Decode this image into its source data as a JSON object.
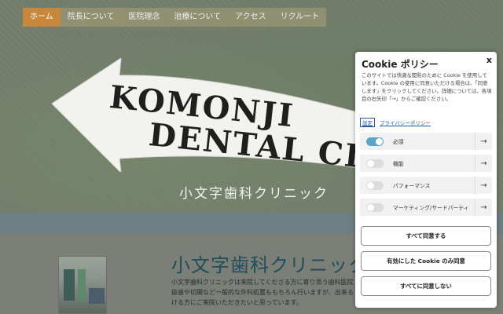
{
  "nav": {
    "items": [
      {
        "label": "ホーム",
        "active": true
      },
      {
        "label": "院長について",
        "active": false
      },
      {
        "label": "医院理念",
        "active": false
      },
      {
        "label": "治療について",
        "active": false
      },
      {
        "label": "アクセス",
        "active": false
      },
      {
        "label": "リクルート",
        "active": false
      }
    ]
  },
  "hero": {
    "banner_line1": "KOMONJI",
    "banner_line2": "DENTAL CLINI",
    "subtitle": "小文字歯科クリニック"
  },
  "main": {
    "title": "小文字歯科クリニック",
    "body": "小文字歯科クリニックは来院してくださる方に寄り添う歯科医院 抜歯や切開など一般的な外科処置ももちろん行いますが、出来る ける方にご来院いただきたいと思っています。"
  },
  "cookie": {
    "title": "Cookie ポリシー",
    "close_label": "x",
    "description": "このサイトでは快適な閲覧のために Cookie を使用しています。Cookie の使用に同意いただける場合は、「同意します」をクリックしてください。詳細については、各項目の右矢印「→」からご確認ください。",
    "links": {
      "settings": "設定",
      "privacy": "プライバシーポリシー"
    },
    "categories": [
      {
        "label": "必須",
        "enabled": true
      },
      {
        "label": "機能",
        "enabled": false
      },
      {
        "label": "パフォーマンス",
        "enabled": false
      },
      {
        "label": "マーケティング/サードパーティ",
        "enabled": false
      }
    ],
    "buttons": {
      "accept_all": "すべて同意する",
      "accept_selected": "有効にした Cookie のみ同意",
      "reject_all": "すべてに同意しない"
    }
  },
  "colors": {
    "nav_active": "#c8873a",
    "toggle_on": "#5aa5c8",
    "title_teal": "#1f4d5a"
  }
}
